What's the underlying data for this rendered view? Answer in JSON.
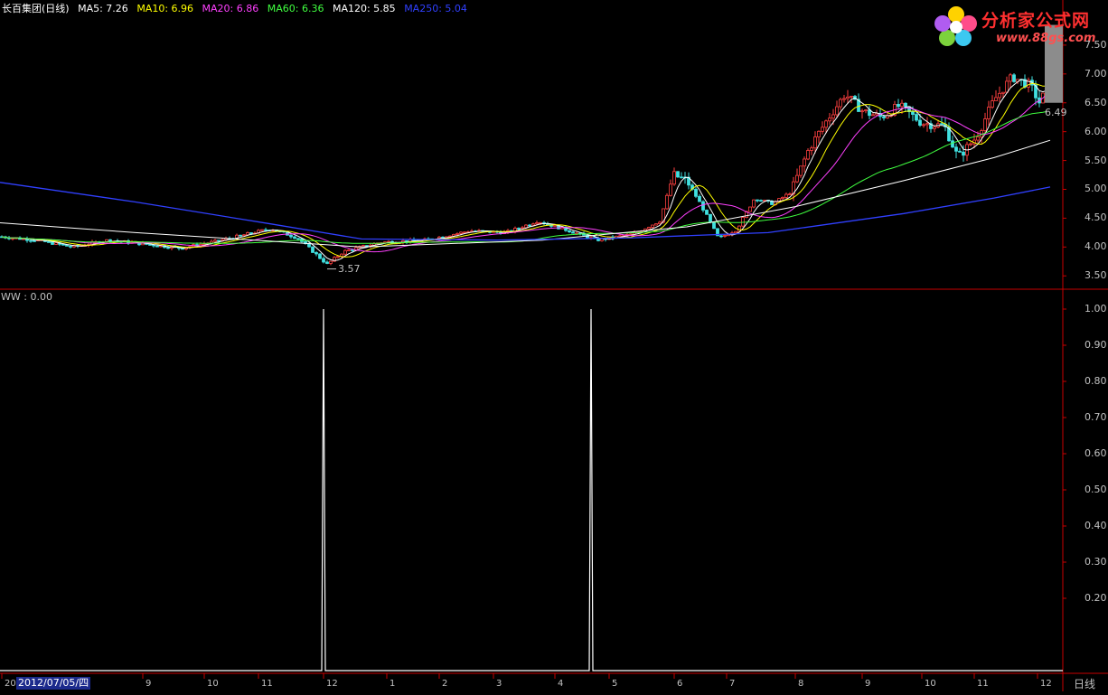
{
  "header": {
    "title": "长百集团(日线)",
    "ma": [
      {
        "label": "MA5: 7.26",
        "color": "#ffffff"
      },
      {
        "label": "MA10: 6.96",
        "color": "#ffff00"
      },
      {
        "label": "MA20: 6.86",
        "color": "#ff40ff"
      },
      {
        "label": "MA60: 6.36",
        "color": "#40ff40"
      },
      {
        "label": "MA120: 5.85",
        "color": "#ffffff"
      },
      {
        "label": "MA250: 5.04",
        "color": "#3040ff"
      }
    ]
  },
  "logo": {
    "title": "分析家公式网",
    "url": "www.88gs.com"
  },
  "indicator": {
    "label": "WW : 0.00"
  },
  "footer": {
    "date": "2012/07/05/四",
    "period": "日线"
  },
  "colors": {
    "up": "#ff4040",
    "down": "#40e0e0",
    "axis": "#c80000",
    "bg": "#000000"
  },
  "chart_data": [
    {
      "type": "candlestick",
      "title": "长百集团(日线)",
      "ylim": [
        3.3,
        8.0
      ],
      "yticks": [
        "3.50",
        "4.00",
        "4.50",
        "5.00",
        "5.50",
        "6.00",
        "6.50",
        "7.00",
        "7.50"
      ],
      "xticks": [
        "20",
        "9",
        "10",
        "11",
        "12",
        "1",
        "2",
        "3",
        "4",
        "5",
        "6",
        "7",
        "8",
        "9",
        "10",
        "11",
        "12"
      ],
      "annotations": [
        {
          "text": "3.57",
          "type": "low"
        },
        {
          "text": "6.49",
          "type": "level"
        }
      ],
      "series": [
        {
          "name": "MA5",
          "approx_closes": [
            4.15,
            4.1,
            4.05,
            4.1,
            4.2,
            4.15,
            4.25,
            4.3,
            4.2,
            3.7,
            3.95,
            4.1,
            4.2,
            4.3,
            4.4,
            4.45,
            4.25,
            4.15,
            4.3,
            4.5,
            5.2,
            4.7,
            4.1,
            4.6,
            4.9,
            5.6,
            6.5,
            6.3,
            6.45,
            6.2,
            5.6,
            6.3,
            6.9,
            6.6,
            7.26
          ]
        },
        {
          "name": "MA250",
          "approx_values": [
            5.1,
            4.7,
            4.3,
            4.12,
            4.15,
            4.2,
            4.3,
            4.5,
            5.04
          ]
        }
      ]
    },
    {
      "type": "line",
      "name": "WW",
      "ylim": [
        0,
        1.0
      ],
      "yticks": [
        "0.20",
        "0.30",
        "0.40",
        "0.50",
        "0.60",
        "0.70",
        "0.80",
        "0.90",
        "1.00"
      ],
      "spikes": [
        {
          "position": "12",
          "value": 1.0
        },
        {
          "position": "4-5",
          "value": 1.0
        }
      ],
      "baseline": 0.0
    }
  ]
}
